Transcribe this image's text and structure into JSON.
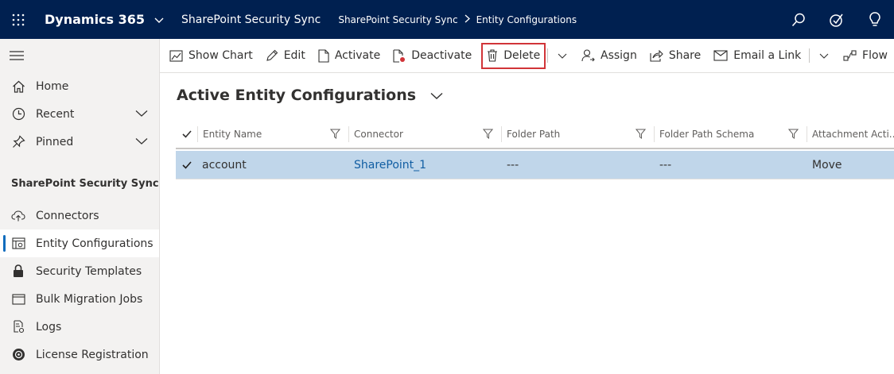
{
  "topbar": {
    "app_name": "Dynamics 365",
    "area_name": "SharePoint Security Sync",
    "breadcrumb": [
      "SharePoint Security Sync",
      "Entity Configurations"
    ],
    "background": "#002050"
  },
  "sidebar": {
    "top_items": [
      {
        "label": "Home",
        "icon": "home-icon"
      },
      {
        "label": "Recent",
        "icon": "clock-icon"
      },
      {
        "label": "Pinned",
        "icon": "pin-icon"
      }
    ],
    "group_title": "SharePoint Security Sync",
    "group_items": [
      {
        "label": "Connectors",
        "icon": "cloud-upload-icon",
        "active": false
      },
      {
        "label": "Entity Configurations",
        "icon": "entity-icon",
        "active": true
      },
      {
        "label": "Security Templates",
        "icon": "lock-icon",
        "active": false
      },
      {
        "label": "Bulk Migration Jobs",
        "icon": "window-icon",
        "active": false
      },
      {
        "label": "Logs",
        "icon": "log-icon",
        "active": false
      },
      {
        "label": "License Registration",
        "icon": "license-icon",
        "active": false
      }
    ]
  },
  "commands": {
    "show_chart": "Show Chart",
    "edit": "Edit",
    "activate": "Activate",
    "deactivate": "Deactivate",
    "delete": "Delete",
    "assign": "Assign",
    "share": "Share",
    "email_link": "Email a Link",
    "flow": "Flow",
    "highlight_color": "#d13438"
  },
  "view": {
    "title": "Active Entity Configurations"
  },
  "grid": {
    "columns": [
      "Entity Name",
      "Connector",
      "Folder Path",
      "Folder Path Schema",
      "Attachment Acti..."
    ],
    "rows": [
      {
        "entity_name": "account",
        "connector": "SharePoint_1",
        "folder_path": "---",
        "folder_path_schema": "---",
        "attachment_action": "Move",
        "selected": true
      }
    ],
    "selected_row_color": "#c0d6ea"
  }
}
